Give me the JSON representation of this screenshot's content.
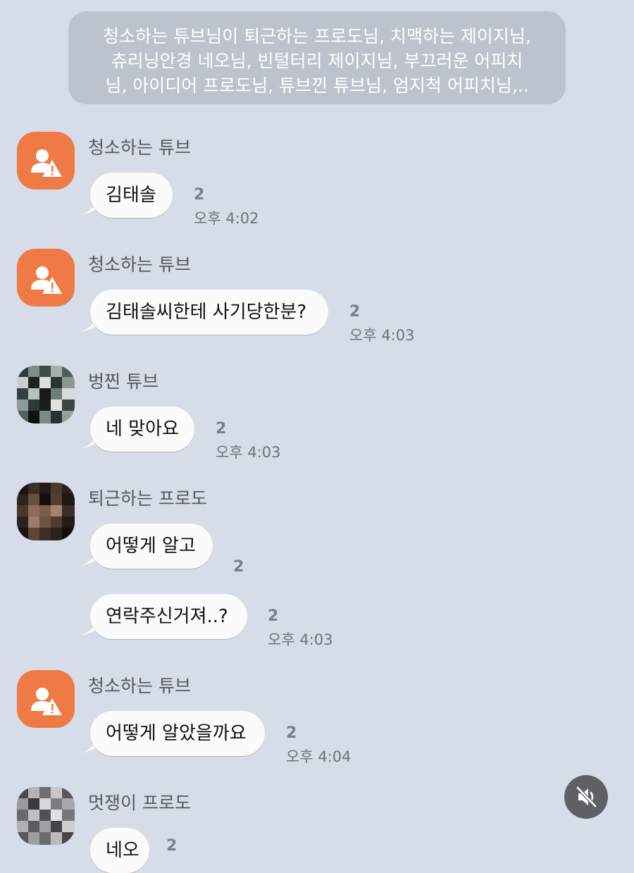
{
  "notice": {
    "line1": "청소하는 튜브님이 퇴근하는 프로도님, 치맥하는 제이지님,",
    "line2": "츄리닝안경 네오님, 빈털터리 제이지님, 부끄러운 어피치",
    "line3": "님, 아이디어 프로도님, 튜브낀 튜브님, 엄지척 어피치님,.."
  },
  "messages": [
    {
      "sender": "청소하는 튜브",
      "text": "김태솔",
      "count": "2",
      "time": "오후 4:02"
    },
    {
      "sender": "청소하는 튜브",
      "text": "김태솔씨한테 사기당한분?",
      "count": "2",
      "time": "오후 4:03"
    },
    {
      "sender": "벙찐 튜브",
      "text": "네 맞아요",
      "count": "2",
      "time": "오후 4:03"
    },
    {
      "sender": "퇴근하는 프로도",
      "text": "어떻게 알고",
      "count": "2",
      "text2": "연락주신거져..?",
      "count2": "2",
      "time": "오후 4:03"
    },
    {
      "sender": "청소하는 튜브",
      "text": "어떻게 알았을까요",
      "count": "2",
      "time": "오후 4:04"
    },
    {
      "sender": "멋쟁이 프로도",
      "text": "네오",
      "count": "2"
    }
  ],
  "icons": {
    "warning_avatar": "user-warning-icon",
    "mute": "speaker-muted-icon"
  },
  "colors": {
    "background": "#d7dde8",
    "notice_bg": "#bcc3cf",
    "avatar_warn": "#ef7a45",
    "bubble": "#fbfbfb",
    "mute_button": "#5d6166"
  }
}
